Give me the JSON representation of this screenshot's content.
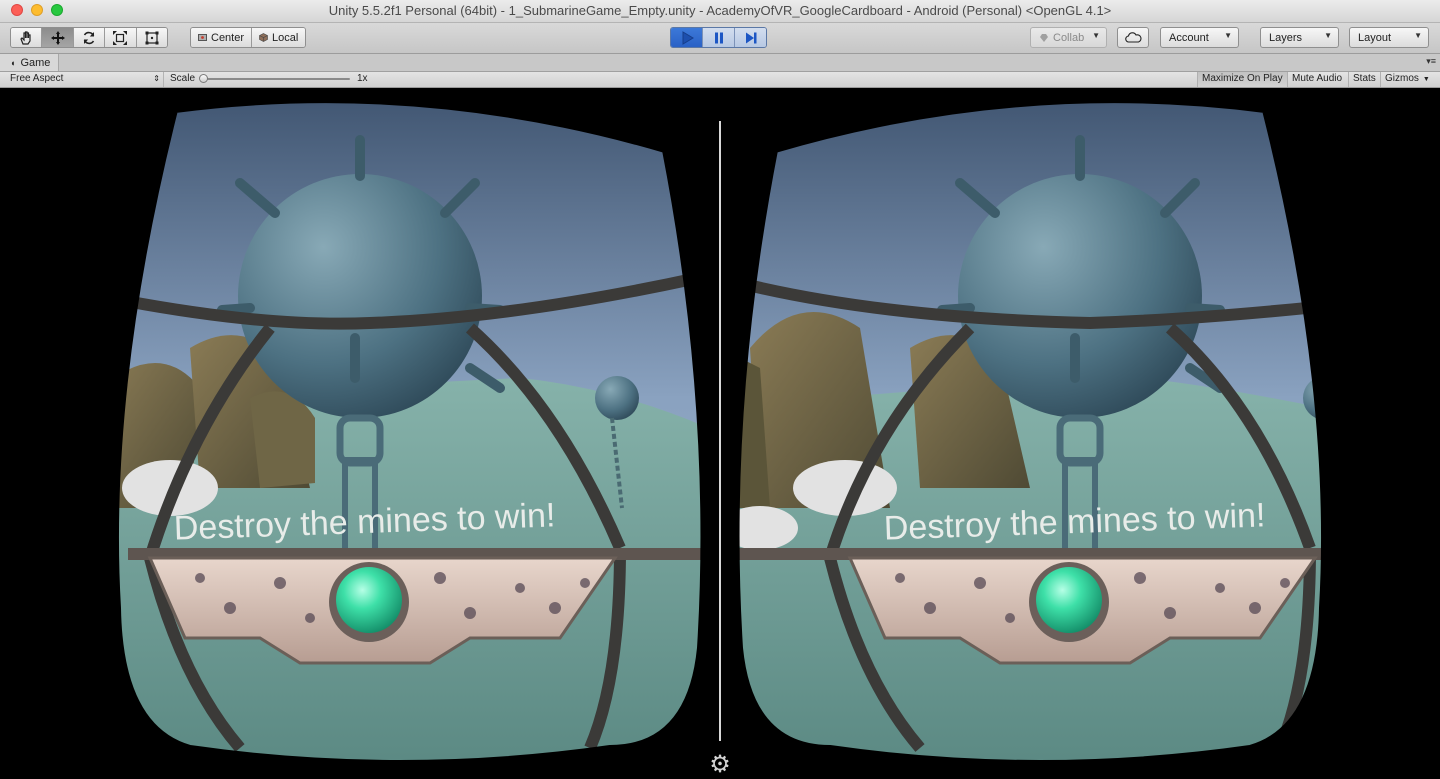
{
  "window": {
    "title": "Unity 5.5.2f1 Personal (64bit) - 1_SubmarineGame_Empty.unity - AcademyOfVR_GoogleCardboard - Android (Personal) <OpenGL 4.1>"
  },
  "toolbar": {
    "transform_tools": [
      "hand-icon",
      "move-icon",
      "rotate-icon",
      "scale-icon",
      "rect-icon"
    ],
    "pivot_mode": "Center",
    "pivot_rotation": "Local",
    "collab_label": "Collab",
    "account_label": "Account",
    "layers_label": "Layers",
    "layout_label": "Layout"
  },
  "game_panel": {
    "tab_label": "Game",
    "aspect": "Free Aspect",
    "scale_label": "Scale",
    "scale_value": "1x",
    "toggles": {
      "maximize_on_play": "Maximize On Play",
      "mute_audio": "Mute Audio",
      "stats": "Stats",
      "gizmos": "Gizmos"
    }
  },
  "scene": {
    "message": "Destroy the mines to win!",
    "mode": "stereo VR split view",
    "colors": {
      "sky_top": "#3f5470",
      "sky_bottom": "#8aa2c0",
      "sea_floor": "#6f9f98",
      "mine": "#4d7182",
      "button_glow": "#3ee0a8"
    }
  }
}
